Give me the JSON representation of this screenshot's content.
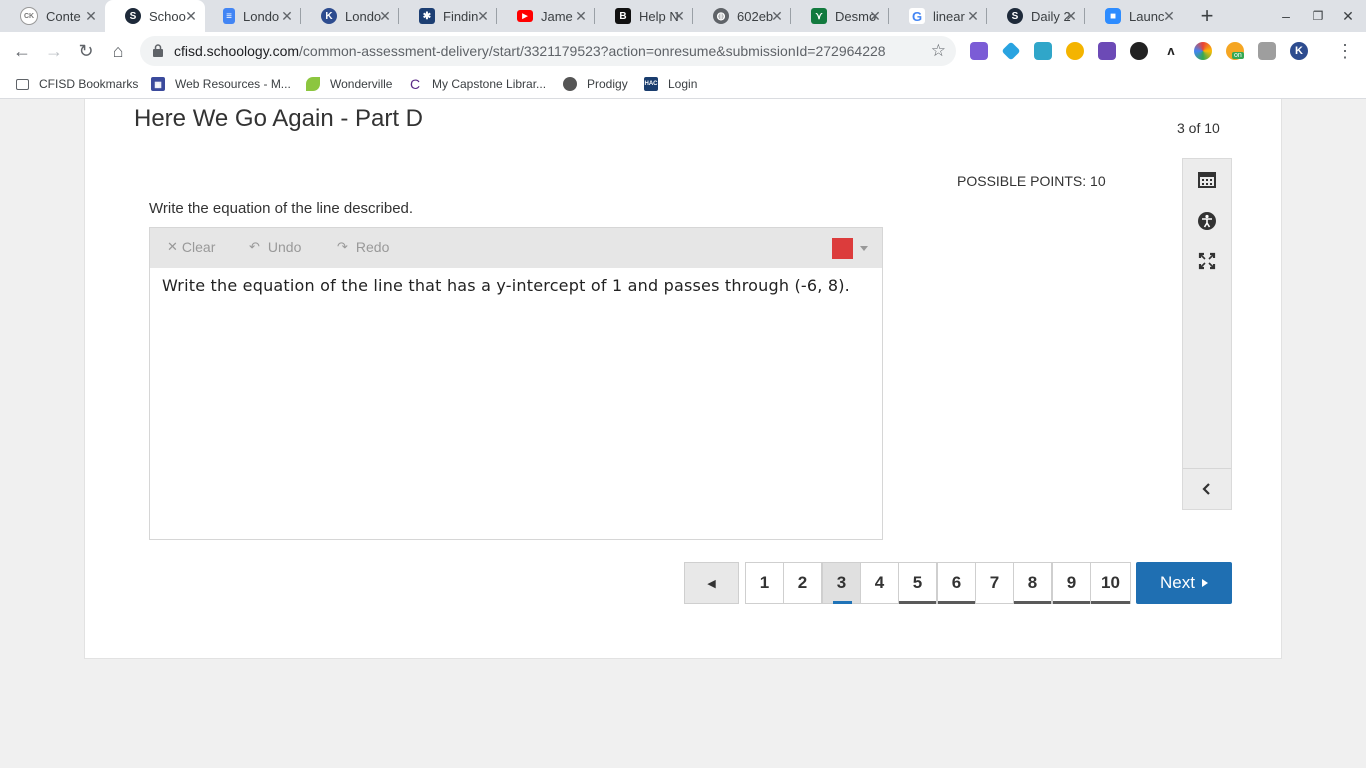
{
  "browser": {
    "tabs": [
      {
        "title": "Conte",
        "icon": "ck-12-icon",
        "color": "#e8e8e8"
      },
      {
        "title": "Schoo",
        "icon": "schoology-icon",
        "color": "#1e2a3a",
        "active": true
      },
      {
        "title": "Londo",
        "icon": "google-docs-icon",
        "color": "#4285f4"
      },
      {
        "title": "Londo",
        "icon": "k-icon",
        "color": "#2d4c8f"
      },
      {
        "title": "Findin",
        "icon": "star-logo-icon",
        "color": "#1d3f73"
      },
      {
        "title": "Jame",
        "icon": "youtube-icon",
        "color": "#ff0000"
      },
      {
        "title": "Help N",
        "icon": "b-icon",
        "color": "#111111"
      },
      {
        "title": "602eb",
        "icon": "globe-icon",
        "color": "#5f6368"
      },
      {
        "title": "Desmo",
        "icon": "desmos-icon",
        "color": "#127a3e"
      },
      {
        "title": "linear",
        "icon": "google-icon",
        "color": "#4285f4"
      },
      {
        "title": "Daily 2",
        "icon": "schoology-icon",
        "color": "#1e2a3a"
      },
      {
        "title": "Launc",
        "icon": "zoom-icon",
        "color": "#2d8cff"
      }
    ],
    "url_host": "cfisd.schoology.com",
    "url_path": "/common-assessment-delivery/start/3321179523?action=onresume&submissionId=272964228",
    "bookmarks": [
      {
        "label": "CFISD Bookmarks",
        "icon": "folder-icon"
      },
      {
        "label": "Web Resources - M...",
        "icon": "grid-icon"
      },
      {
        "label": "Wonderville",
        "icon": "leaf-icon"
      },
      {
        "label": "My Capstone Librar...",
        "icon": "capstone-icon"
      },
      {
        "label": "Prodigy",
        "icon": "prodigy-icon"
      },
      {
        "label": "Login",
        "icon": "hac-icon"
      }
    ],
    "hac_text": "HAC",
    "ext_badge": "on"
  },
  "assessment": {
    "title": "Here We Go Again - Part D",
    "counter": "3 of 10",
    "possible_points": "POSSIBLE POINTS: 10",
    "prompt": "Write the equation of the line described.",
    "editor": {
      "clear_label": "Clear",
      "undo_label": "Undo",
      "redo_label": "Redo",
      "pen_color": "#dc3c3c",
      "content": "Write the equation of the line that has a y-intercept of 1 and passes through (-6, 8)."
    },
    "pager": {
      "pages": [
        "1",
        "2",
        "3",
        "4",
        "5",
        "6",
        "7",
        "8",
        "9",
        "10"
      ],
      "current": "3",
      "next_label": "Next"
    }
  }
}
